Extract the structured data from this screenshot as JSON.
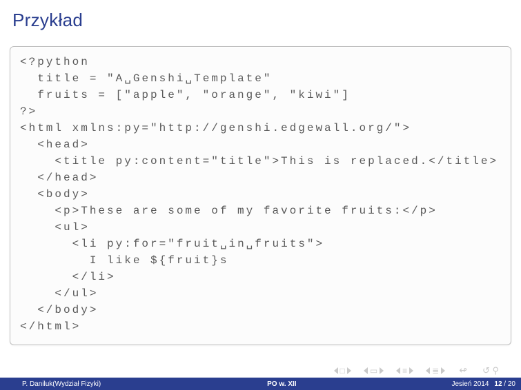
{
  "title": "Przykład",
  "code": "<?python\n  title = \"A␣Genshi␣Template\"\n  fruits = [\"apple\", \"orange\", \"kiwi\"]\n?>\n<html xmlns:py=\"http://genshi.edgewall.org/\">\n  <head>\n    <title py:content=\"title\">This is replaced.</title>\n  </head>\n  <body>\n    <p>These are some of my favorite fruits:</p>\n    <ul>\n      <li py:for=\"fruit␣in␣fruits\">\n        I like ${fruit}s\n      </li>\n    </ul>\n  </body>\n</html>",
  "footer": {
    "author": "P. Daniluk(Wydział Fizyki)",
    "center": "PO w. XII",
    "term": "Jesień 2014",
    "page_current": "12",
    "page_total": "20"
  }
}
